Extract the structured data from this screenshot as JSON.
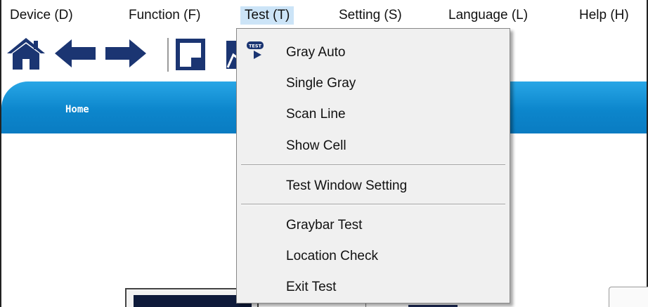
{
  "menubar": {
    "items": [
      {
        "label": "Device (D)"
      },
      {
        "label": "Function (F)"
      },
      {
        "label": "Test (T)",
        "active": true
      },
      {
        "label": "Setting (S)"
      },
      {
        "label": "Language (L)"
      },
      {
        "label": "Help (H)"
      }
    ]
  },
  "toolbar": {
    "icons": [
      "home-icon",
      "back-arrow-icon",
      "forward-arrow-icon",
      "save-icon",
      "chart-icon"
    ]
  },
  "nav": {
    "home_label": "Home"
  },
  "test_menu": {
    "badge_text": "TEST",
    "groups": [
      [
        "Gray Auto",
        "Single Gray",
        "Scan Line",
        "Show Cell"
      ],
      [
        "Test Window Setting"
      ],
      [
        "Graybar Test",
        "Location Check",
        "Exit Test"
      ]
    ]
  },
  "colors": {
    "menu_active_bg": "#cce4f7",
    "nav_band": "#0c86cc",
    "icon_navy": "#1b3572",
    "dropdown_bg": "#f0f0f0"
  }
}
